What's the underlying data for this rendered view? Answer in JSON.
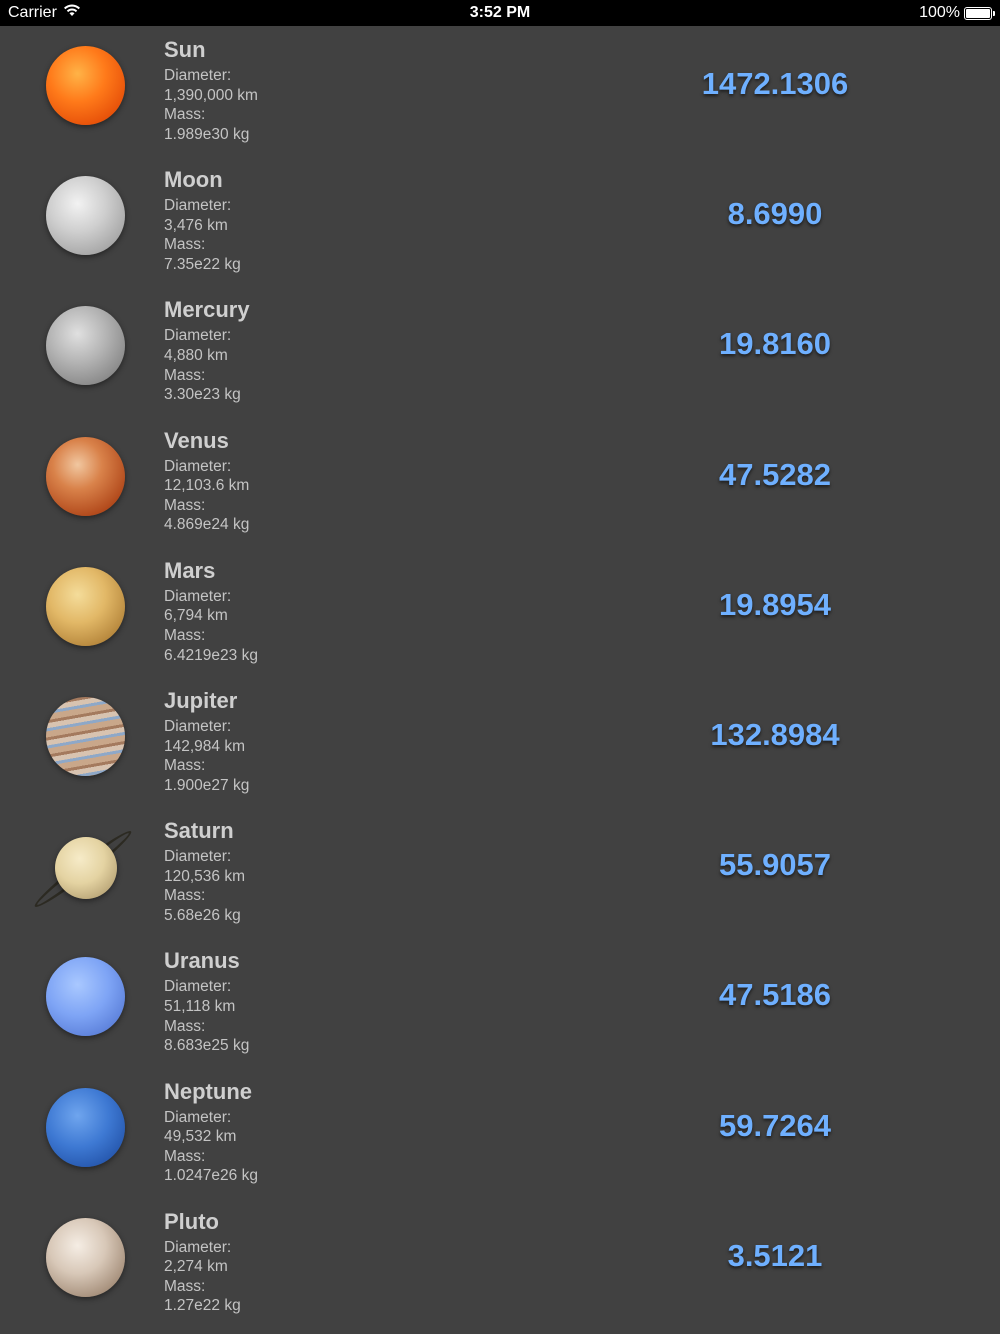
{
  "status_bar": {
    "carrier": "Carrier",
    "time": "3:52 PM",
    "battery": "100%",
    "battery_level": 1.0
  },
  "planets": [
    {
      "name": "Sun",
      "diameter_label": "Diameter:",
      "diameter": "1,390,000 km",
      "mass_label": "Mass:",
      "mass": "1.989e30 kg",
      "value": "1472.1306",
      "icon": "sun-icon"
    },
    {
      "name": "Moon",
      "diameter_label": "Diameter:",
      "diameter": "3,476 km",
      "mass_label": "Mass:",
      "mass": "7.35e22 kg",
      "value": "8.6990",
      "icon": "moon-icon"
    },
    {
      "name": "Mercury",
      "diameter_label": "Diameter:",
      "diameter": "4,880 km",
      "mass_label": "Mass:",
      "mass": "3.30e23 kg",
      "value": "19.8160",
      "icon": "mercury-icon"
    },
    {
      "name": "Venus",
      "diameter_label": "Diameter:",
      "diameter": "12,103.6 km",
      "mass_label": "Mass:",
      "mass": "4.869e24 kg",
      "value": "47.5282",
      "icon": "venus-icon"
    },
    {
      "name": "Mars",
      "diameter_label": "Diameter:",
      "diameter": "6,794 km",
      "mass_label": "Mass:",
      "mass": "6.4219e23 kg",
      "value": "19.8954",
      "icon": "mars-icon"
    },
    {
      "name": "Jupiter",
      "diameter_label": "Diameter:",
      "diameter": "142,984 km",
      "mass_label": "Mass:",
      "mass": "1.900e27 kg",
      "value": "132.8984",
      "icon": "jupiter-icon"
    },
    {
      "name": "Saturn",
      "diameter_label": "Diameter:",
      "diameter": "120,536 km",
      "mass_label": "Mass:",
      "mass": "5.68e26 kg",
      "value": "55.9057",
      "icon": "saturn-icon"
    },
    {
      "name": "Uranus",
      "diameter_label": "Diameter:",
      "diameter": "51,118 km",
      "mass_label": "Mass:",
      "mass": "8.683e25 kg",
      "value": "47.5186",
      "icon": "uranus-icon"
    },
    {
      "name": "Neptune",
      "diameter_label": "Diameter:",
      "diameter": "49,532 km",
      "mass_label": "Mass:",
      "mass": "1.0247e26 kg",
      "value": "59.7264",
      "icon": "neptune-icon"
    },
    {
      "name": "Pluto",
      "diameter_label": "Diameter:",
      "diameter": "2,274 km",
      "mass_label": "Mass:",
      "mass": "1.27e22 kg",
      "value": "3.5121",
      "icon": "pluto-icon"
    }
  ],
  "colors": {
    "background": "#414141",
    "value_text": "#6fb0ff",
    "status_bar": "#000000"
  }
}
